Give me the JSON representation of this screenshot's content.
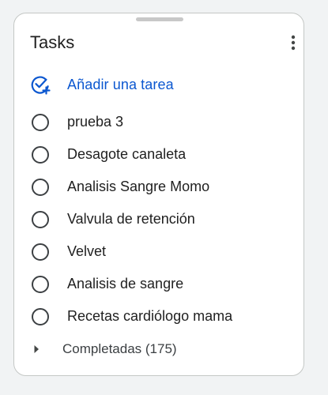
{
  "header": {
    "title": "Tasks"
  },
  "add_task": {
    "label": "Añadir una tarea",
    "icon": "add-task-icon"
  },
  "tasks": [
    {
      "title": "prueba 3"
    },
    {
      "title": "Desagote canaleta"
    },
    {
      "title": "Analisis Sangre Momo"
    },
    {
      "title": "Valvula de retención"
    },
    {
      "title": "Velvet"
    },
    {
      "title": "Analisis de sangre"
    },
    {
      "title": "Recetas cardiólogo mama"
    }
  ],
  "completed": {
    "label": "Completadas (175)"
  },
  "colors": {
    "accent": "#0b57d0",
    "text": "#1f1f1f",
    "border": "#c4c7c5"
  }
}
